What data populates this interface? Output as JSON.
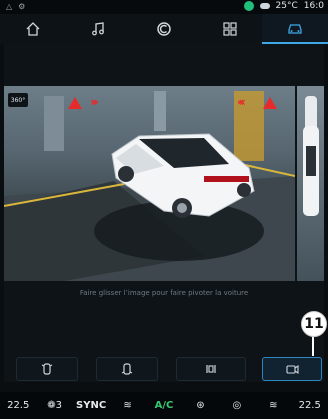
{
  "statusbar": {
    "temperature": "25°C",
    "time": "16:0"
  },
  "navbar": {
    "items": [
      {
        "icon": "home-icon"
      },
      {
        "icon": "music-icon"
      },
      {
        "icon": "phone-app-icon"
      },
      {
        "icon": "apps-grid-icon"
      },
      {
        "icon": "car-icon",
        "active": true
      }
    ]
  },
  "camera": {
    "badge": "360°",
    "caption": "Faire glisser l’image pour faire pivoter la voiture"
  },
  "functions": {
    "buttons": [
      {
        "icon": "front-camera-icon"
      },
      {
        "icon": "rear-camera-icon"
      },
      {
        "icon": "sensor-settings-icon"
      },
      {
        "icon": "top-view-camera-icon",
        "active": true
      }
    ],
    "callout_number": "11"
  },
  "climate": {
    "left_temp": "22.5",
    "fan_speed": "3",
    "sync_label": "SYNC",
    "ac_label": "A/C",
    "right_temp": "22.5"
  }
}
